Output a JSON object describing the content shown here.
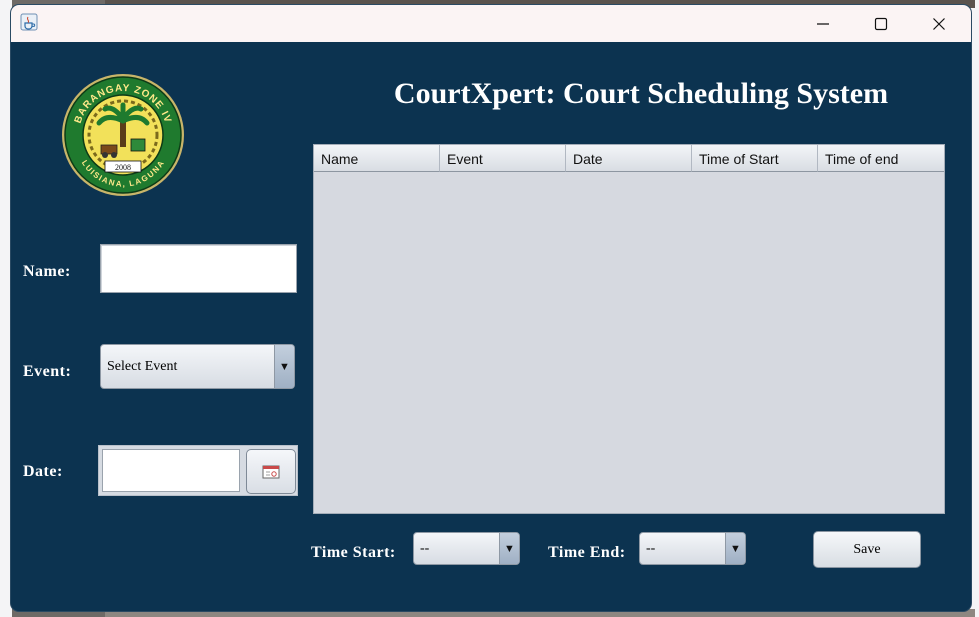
{
  "window": {
    "title": "",
    "controls": {
      "minimize_icon": "minimize-icon",
      "maximize_icon": "maximize-icon",
      "close_icon": "close-icon"
    }
  },
  "header": {
    "title": "CourtXpert: Court Scheduling System",
    "logo": {
      "top_text": "BARANGAY ZONE IV",
      "bottom_text": "LUISIANA, LAGUNA",
      "year": "2008"
    }
  },
  "form": {
    "name_label": "Name:",
    "name_value": "",
    "event_label": "Event:",
    "event_selected": "Select Event",
    "date_label": "Date:",
    "date_value": "",
    "calendar_icon": "calendar-icon"
  },
  "table": {
    "columns": [
      "Name",
      "Event",
      "Date",
      "Time of Start",
      "Time of end"
    ],
    "rows": []
  },
  "footer": {
    "time_start_label": "Time Start:",
    "time_start_selected": "--",
    "time_end_label": "Time End:",
    "time_end_selected": "--",
    "save_label": "Save"
  },
  "colors": {
    "panel_bg": "#0c3350",
    "title_text": "#ffffff",
    "table_bg": "#d6d9e0",
    "titlebar_bg": "#fbf4f4"
  }
}
